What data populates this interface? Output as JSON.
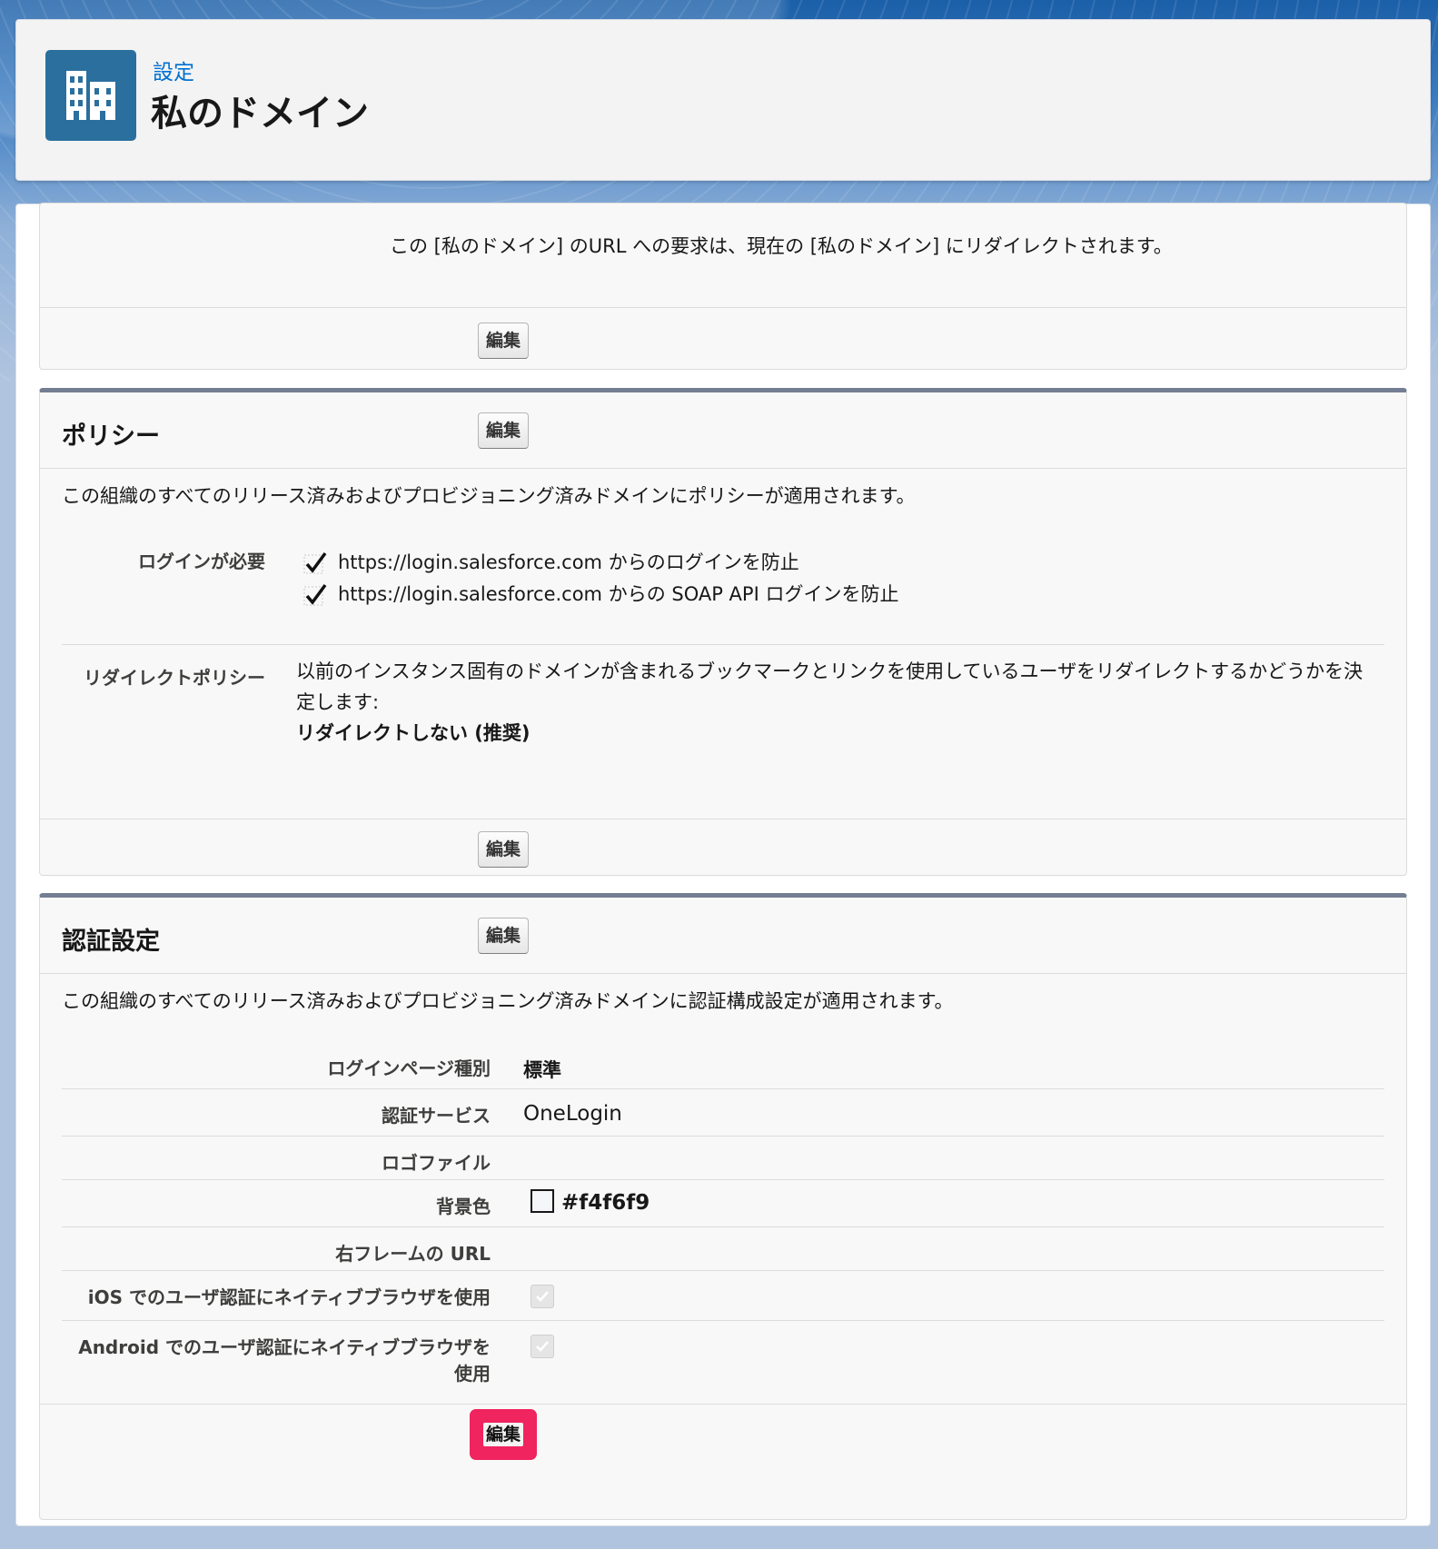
{
  "header": {
    "breadcrumb": "設定",
    "title": "私のドメイン",
    "icon": "building-icon"
  },
  "redirect_section": {
    "message": "この [私のドメイン] のURL への要求は、現在の [私のドメイン] にリダイレクトされます。",
    "edit_label": "編集"
  },
  "policy": {
    "title": "ポリシー",
    "edit_label": "編集",
    "description": "この組織のすべてのリリース済みおよびプロビジョニング済みドメインにポリシーが適用されます。",
    "login_required_label": "ログインが必要",
    "login_options": [
      "https://login.salesforce.com からのログインを防止",
      "https://login.salesforce.com からの SOAP API ログインを防止"
    ],
    "redirect_policy_label": "リダイレクトポリシー",
    "redirect_policy_description": "以前のインスタンス固有のドメインが含まれるブックマークとリンクを使用しているユーザをリダイレクトするかどうかを決定します:",
    "redirect_policy_value": "リダイレクトしない (推奨)",
    "footer_edit_label": "編集"
  },
  "auth": {
    "title": "認証設定",
    "edit_label": "編集",
    "description": "この組織のすべてのリリース済みおよびプロビジョニング済みドメインに認証構成設定が適用されます。",
    "fields": {
      "login_page_type_label": "ログインページ種別",
      "login_page_type_value": "標準",
      "auth_service_label": "認証サービス",
      "auth_service_value": "OneLogin",
      "logo_file_label": "ロゴファイル",
      "bg_color_label": "背景色",
      "bg_color_value": "#f4f6f9",
      "right_frame_label": "右フレームの URL",
      "ios_native_label": "iOS でのユーザ認証にネイティブブラウザを使用",
      "ios_native_checked": true,
      "android_native_label": "Android でのユーザ認証にネイティブブラウザを使用",
      "android_native_checked": true
    },
    "footer_edit_label": "編集"
  },
  "colors": {
    "accent_link": "#0070d2",
    "icon_bg": "#2a6f9e",
    "highlight": "#f0245f",
    "panel_border_top": "#747e92"
  }
}
